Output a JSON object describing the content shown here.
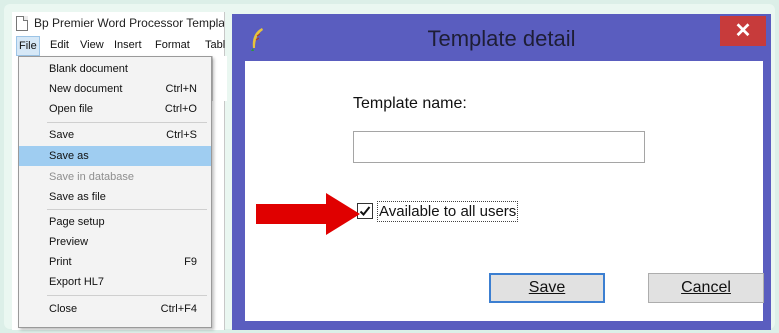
{
  "left_window": {
    "title": "Bp Premier Word Processor Template -",
    "menubar": [
      "File",
      "Edit",
      "View",
      "Insert",
      "Format",
      "Tabl"
    ],
    "file_menu": [
      {
        "label": "Blank document",
        "shortcut": ""
      },
      {
        "label": "New document",
        "shortcut": "Ctrl+N"
      },
      {
        "label": "Open file",
        "shortcut": "Ctrl+O"
      },
      {
        "label": "Save",
        "shortcut": "Ctrl+S"
      },
      {
        "label": "Save as",
        "shortcut": "",
        "highlighted": true
      },
      {
        "label": "Save in database",
        "shortcut": "",
        "disabled": true
      },
      {
        "label": "Save as file",
        "shortcut": ""
      },
      {
        "label": "Page setup",
        "shortcut": ""
      },
      {
        "label": "Preview",
        "shortcut": ""
      },
      {
        "label": "Print",
        "shortcut": "F9"
      },
      {
        "label": "Export HL7",
        "shortcut": ""
      },
      {
        "label": "Close",
        "shortcut": "Ctrl+F4"
      }
    ]
  },
  "dialog": {
    "title": "Template detail",
    "close_label": "✕",
    "template_name_label": "Template name:",
    "template_name_value": "",
    "available_label": "Available to all users",
    "available_checked": true,
    "save_label": "Save",
    "cancel_label": "Cancel"
  },
  "colors": {
    "dialog_frame": "#5a5dbf",
    "close_button": "#c73b3b",
    "menu_highlight": "#9fcdf1",
    "arrow": "#e00000"
  }
}
